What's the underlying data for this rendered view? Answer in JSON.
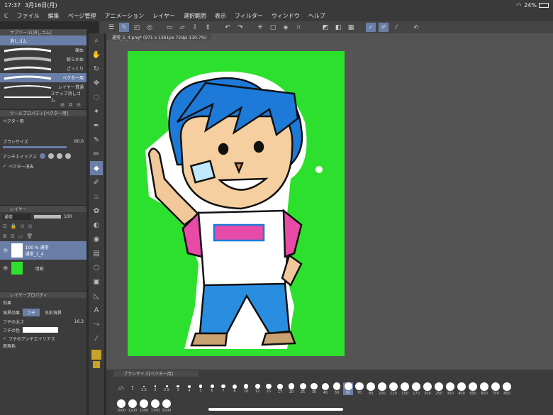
{
  "status": {
    "time": "17:37",
    "date": "3月16日(月)",
    "battery": "24%"
  },
  "menu": [
    "ファイル",
    "編集",
    "ページ管理",
    "アニメーション",
    "レイヤー",
    "選択範囲",
    "表示",
    "フィルター",
    "ウィンドウ",
    "ヘルプ"
  ],
  "subtool": {
    "header": "サブツール[消しゴム]",
    "group": "消しゴム",
    "items": [
      "硬め",
      "軟らかめ",
      "ざっくり",
      "ベクター用",
      "レイヤー貫通",
      "スナップ消しゴム"
    ]
  },
  "toolprop": {
    "header": "ツールプロパティ[ベクター用]",
    "name": "ベクター用",
    "brush_size_label": "ブラシサイズ",
    "brush_size": "60.0",
    "aa_label": "アンチエイリアス",
    "vector_erase_label": "ベクター消去"
  },
  "layer": {
    "header": "レイヤー",
    "blend": "通常",
    "opacity": "100",
    "rows": [
      {
        "line1": "100 % 通常",
        "line2": "通常_1_4"
      },
      {
        "line1": "",
        "line2": "用紙"
      }
    ]
  },
  "layerprop": {
    "header": "レイヤープロパティ",
    "effect_label": "効果",
    "border_label": "境界効果",
    "fuchi_label": "フチ",
    "watercolor_label": "水彩境界",
    "width_label": "フチの太さ",
    "width_value": "16.3",
    "color_label": "フチの色",
    "aa_label": "フチのアンチエイリアス",
    "expression_label": "表現色"
  },
  "doc_tab": "通常_1_4.png* (971 x 1361px 72dpi 110.7%)",
  "brushsize": {
    "header": "ブラシサイズ[ベクター用]",
    "row1": [
      "0.7",
      "1",
      "1.5",
      "2",
      "2.5",
      "3",
      "4",
      "5",
      "6",
      "7",
      "8",
      "10",
      "12",
      "15",
      "17",
      "20",
      "25",
      "30",
      "40",
      "50",
      "60",
      "70",
      "80",
      "100",
      "120",
      "150",
      "170",
      "200",
      "250",
      "300",
      "400",
      "500",
      "600",
      "700",
      "800"
    ],
    "row2": [
      "1000",
      "1200",
      "1500",
      "1700",
      "2000"
    ],
    "selected": "60"
  },
  "colors": {
    "canvas_bg": "#2ee02e",
    "accent": "#6a7fa8",
    "hair": "#1e7ad8",
    "shirt": "#e84aa8",
    "pants": "#2a8ee0"
  }
}
